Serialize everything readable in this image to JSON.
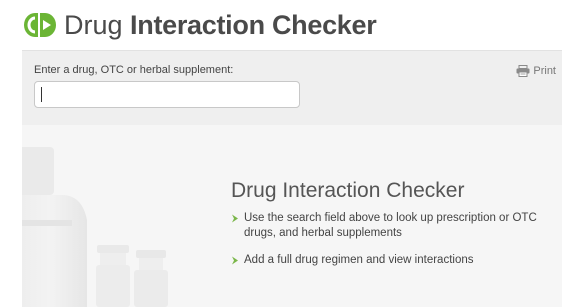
{
  "header": {
    "title_light": "Drug",
    "title_bold": "Interaction Checker"
  },
  "search": {
    "label": "Enter a drug, OTC or herbal supplement:",
    "value": "",
    "placeholder": ""
  },
  "toolbar": {
    "print_label": "Print"
  },
  "hero": {
    "title": "Drug Interaction Checker",
    "bullets": [
      "Use the search field above to look up prescription or OTC drugs, and herbal supplements",
      "Add a full drug regimen and view interactions"
    ]
  },
  "colors": {
    "brand_green": "#6bb535",
    "bullet_green": "#7ab648",
    "title_gray": "#4a4a4a"
  }
}
